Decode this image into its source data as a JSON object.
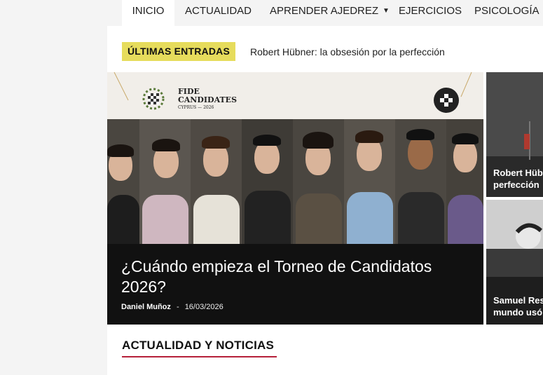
{
  "nav": {
    "items": [
      {
        "label": "INICIO",
        "active": true
      },
      {
        "label": "ACTUALIDAD"
      },
      {
        "label": "APRENDER AJEDREZ",
        "dropdown": true
      },
      {
        "label": "EJERCICIOS"
      },
      {
        "label": "PSICOLOGÍA"
      }
    ]
  },
  "ticker": {
    "badge": "ÚLTIMAS ENTRADAS",
    "headline": "Robert Hübner: la obsesión por la perfección"
  },
  "hero": {
    "banner_logo_line1": "FIDE",
    "banner_logo_line2": "CANDIDATES",
    "banner_logo_line3": "CYPRUS — 2026",
    "title": "¿Cuándo empieza el Torneo de Candidatos 2026?",
    "author": "Daniel Muñoz",
    "separator": "-",
    "date": "16/03/2026"
  },
  "side_cards": [
    {
      "line1": "Robert Hüb",
      "line2": "perfección"
    },
    {
      "line1": "Samuel Res",
      "line2": "mundo usó"
    }
  ],
  "section": {
    "title": "ACTUALIDAD Y NOTICIAS"
  },
  "colors": {
    "badge": "#e6dc5c",
    "accent": "#b5203a"
  }
}
